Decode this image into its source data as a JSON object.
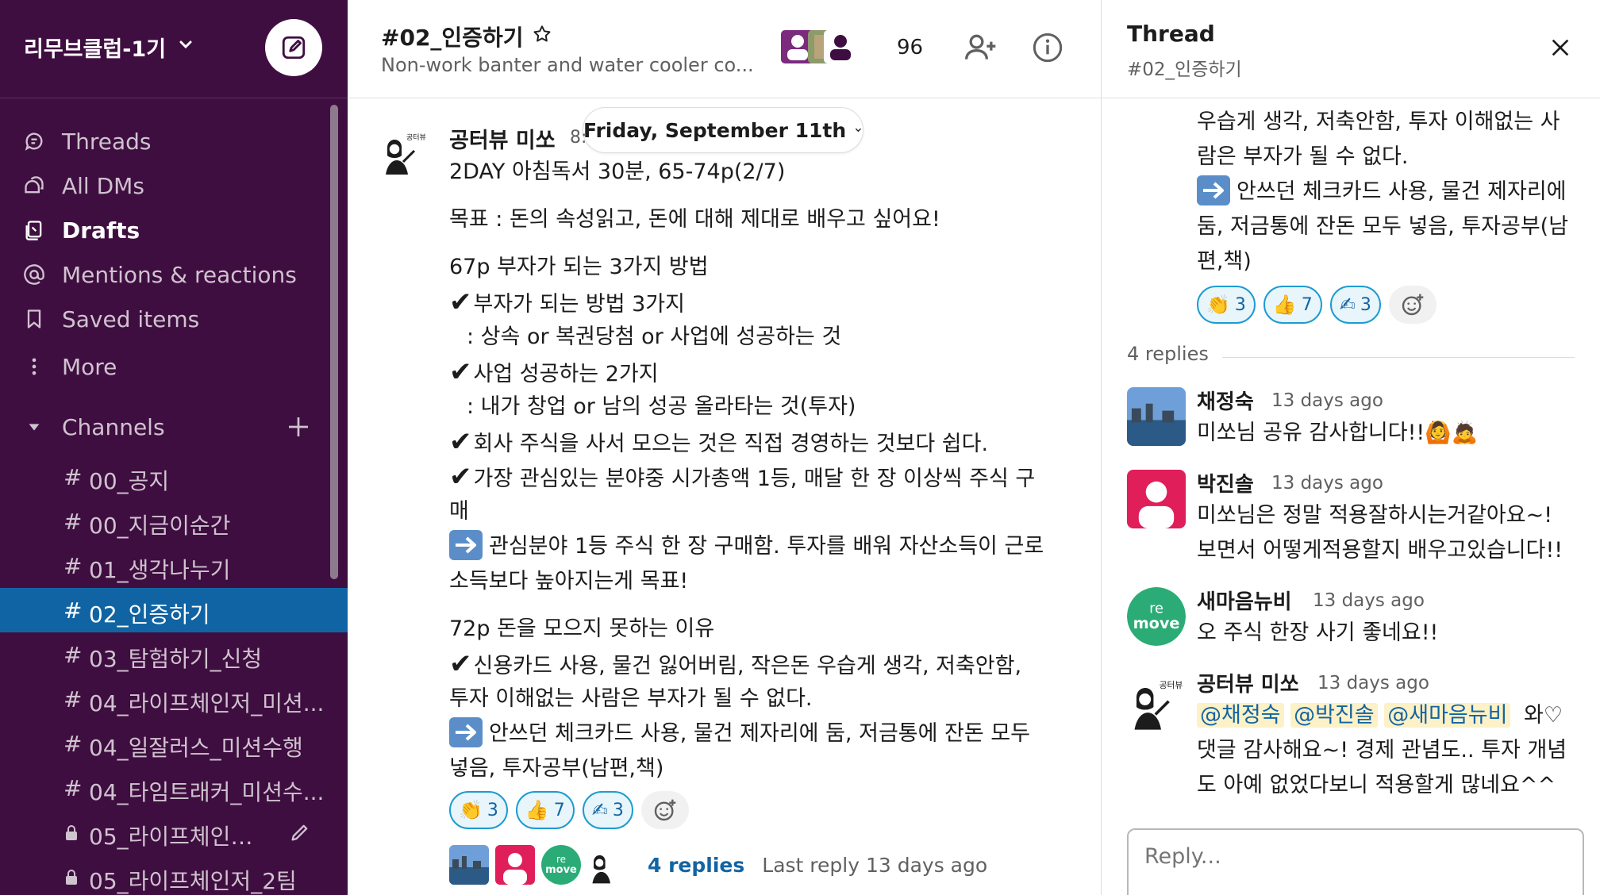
{
  "workspace": {
    "name": "리무브클럽-1기"
  },
  "sidebar": {
    "nav": [
      {
        "label": "Threads"
      },
      {
        "label": "All DMs"
      },
      {
        "label": "Drafts"
      },
      {
        "label": "Mentions & reactions"
      },
      {
        "label": "Saved items"
      },
      {
        "label": "More"
      }
    ],
    "channels_label": "Channels",
    "channels": [
      {
        "name": "00_공지",
        "prefix": "#"
      },
      {
        "name": "00_지금이순간",
        "prefix": "#"
      },
      {
        "name": "01_생각나누기",
        "prefix": "#"
      },
      {
        "name": "02_인증하기",
        "prefix": "#"
      },
      {
        "name": "03_탐험하기_신청",
        "prefix": "#"
      },
      {
        "name": "04_라이프체인저_미션...",
        "prefix": "#"
      },
      {
        "name": "04_일잘러스_미션수행",
        "prefix": "#"
      },
      {
        "name": "04_타임트래커_미션수...",
        "prefix": "#"
      },
      {
        "name": "05_라이프체인저...",
        "prefix": "lock"
      },
      {
        "name": "05_라이프체인저_2팀",
        "prefix": "lock"
      }
    ]
  },
  "channel": {
    "title": "#02_인증하기",
    "topic": "Non-work banter and water cooler co...",
    "member_count": "96"
  },
  "date_divider": "Friday, September 11th",
  "message": {
    "author": "공터뷰 미쏘",
    "time": "8:",
    "lines": [
      "2DAY 아침독서 30분, 65-74p(2/7)",
      " 목표 : 돈의 속성읽고, 돈에 대해 제대로 배우고 싶어요!",
      "67p 부자가 되는 3가지 방법",
      "부자가 되는 방법 3가지",
      "  : 상속 or 복권당첨 or 사업에 성공하는 것",
      "사업 성공하는 2가지",
      "  : 내가 창업 or 남의 성공 올라타는 것(투자)",
      "회사 주식을 사서 모으는 것은 직접 경영하는 것보다 쉽다.",
      "가장 관심있는 분야중 시가총액 1등, 매달 한 장 이상씩 주식 구",
      "매",
      "관심분야 1등 주식 한 장 구매함. 투자를 배워 자산소득이 근로",
      "소득보다 높아지는게 목표!",
      "72p 돈을 모으지 못하는 이유",
      "신용카드 사용, 물건 잃어버림, 작은돈 우습게 생각, 저축안함,",
      "투자 이해없는 사람은 부자가 될 수 없다.",
      "안쓰던 체크카드 사용, 물건 제자리에 둠, 저금통에 잔돈 모두",
      "넣음, 투자공부(남편,책)"
    ],
    "reactions": [
      {
        "emoji": "👏",
        "count": "3"
      },
      {
        "emoji": "👍",
        "count": "7"
      },
      {
        "emoji": "✍",
        "count": "3"
      }
    ],
    "replies_label": "4 replies",
    "last_reply": "Last reply 13 days ago"
  },
  "thread": {
    "title": "Thread",
    "channel": "#02_인증하기",
    "parent_tail": [
      "우습게 생각, 저축안함, 투자 이해없는 사",
      "람은 부자가 될 수 없다.",
      "안쓰던 체크카드 사용, 물건 제자리에",
      "둠, 저금통에 잔돈 모두 넣음, 투자공부(남",
      "편,책)"
    ],
    "reactions": [
      {
        "emoji": "👏",
        "count": "3"
      },
      {
        "emoji": "👍",
        "count": "7"
      },
      {
        "emoji": "✍",
        "count": "3"
      }
    ],
    "replies_count_label": "4 replies",
    "replies": [
      {
        "author": "채정숙",
        "time": "13 days ago",
        "lines": [
          "미쏘님 공유 감사합니다!!🙆🙇"
        ]
      },
      {
        "author": "박진솔",
        "time": "13 days ago",
        "lines": [
          "미쏘님은 정말 적용잘하시는거같아요~!",
          "보면서 어떻게적용할지 배우고있습니다!!"
        ]
      },
      {
        "author": "새마음뉴비",
        "time": "13 days ago",
        "lines": [
          "오 주식 한장 사기 좋네요!!"
        ]
      },
      {
        "author": "공터뷰 미쏘",
        "time": "13 days ago",
        "mentions": [
          "@채정숙",
          "@박진솔",
          "@새마음뉴비"
        ],
        "mention_tail": "와♡",
        "lines": [
          "댓글 감사해요~! 경제 관념도.. 투자 개념",
          "도 아예 없었다보니 적용할게 많네요^^"
        ]
      }
    ],
    "reply_placeholder": "Reply..."
  },
  "avatar_labels": {
    "gongteobyu": "공터뷰",
    "remove_top": "re",
    "remove_bottom": "move"
  },
  "colors": {
    "sidebar": "#3f0e40",
    "active_channel": "#1164a3",
    "link": "#1264a3",
    "reaction_border": "#1d9bd1",
    "mention_bg": "#fdf1c7"
  }
}
